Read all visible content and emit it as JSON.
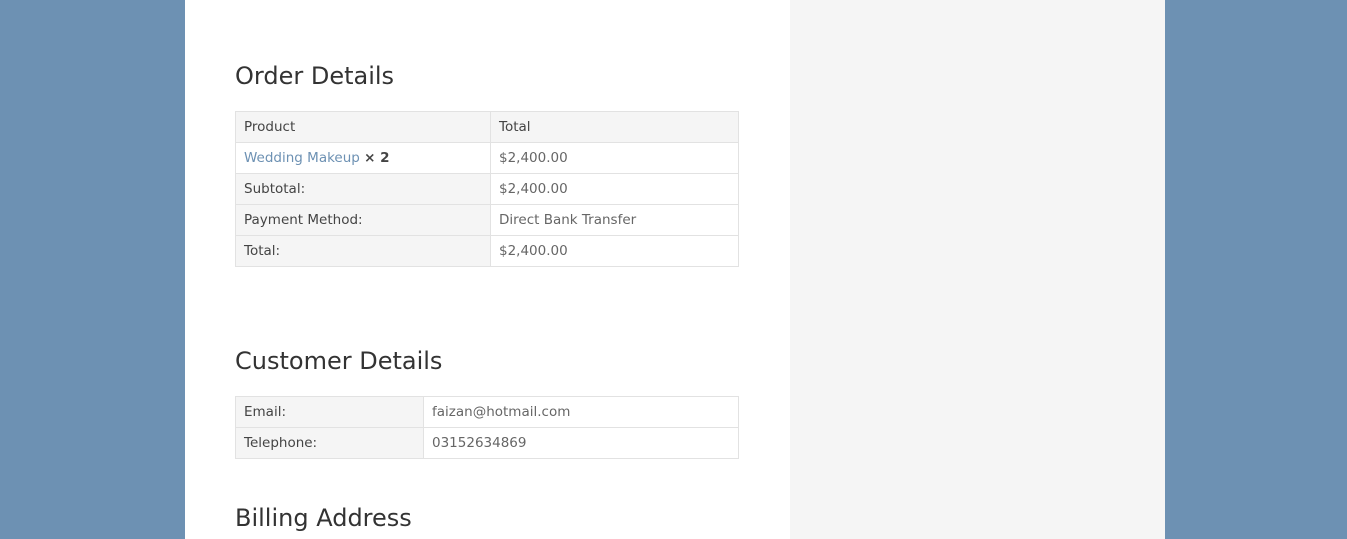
{
  "order_details": {
    "heading": "Order Details",
    "columns": {
      "product": "Product",
      "total": "Total"
    },
    "item": {
      "name": "Wedding Makeup",
      "qty": "× 2",
      "total": "$2,400.00"
    },
    "subtotal": {
      "label": "Subtotal:",
      "value": "$2,400.00"
    },
    "payment_method": {
      "label": "Payment Method:",
      "value": "Direct Bank Transfer"
    },
    "total": {
      "label": "Total:",
      "value": "$2,400.00"
    }
  },
  "customer_details": {
    "heading": "Customer Details",
    "email": {
      "label": "Email:",
      "value": "faizan@hotmail.com"
    },
    "telephone": {
      "label": "Telephone:",
      "value": "03152634869"
    }
  },
  "billing_address": {
    "heading": "Billing Address"
  },
  "colors": {
    "page_background": "#6d91b3",
    "link": "#6d91b3",
    "sidebar": "#f5f5f5"
  }
}
